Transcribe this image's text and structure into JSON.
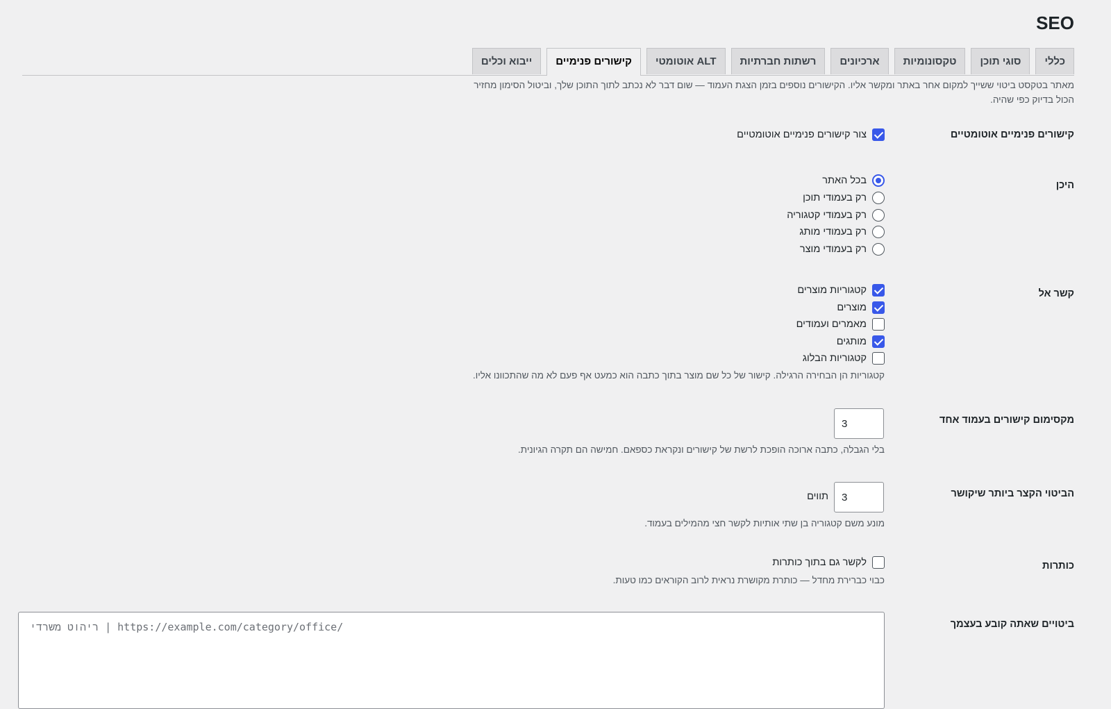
{
  "page": {
    "title": "SEO"
  },
  "tabs": [
    {
      "label": "כללי",
      "active": false
    },
    {
      "label": "סוגי תוכן",
      "active": false
    },
    {
      "label": "טקסונומיות",
      "active": false
    },
    {
      "label": "ארכיונים",
      "active": false
    },
    {
      "label": "רשתות חברתיות",
      "active": false
    },
    {
      "label": "ALT אוטומטי",
      "active": false
    },
    {
      "label": "קישורים פנימיים",
      "active": true
    },
    {
      "label": "ייבוא וכלים",
      "active": false
    }
  ],
  "intro": "מאתר בטקסט ביטוי ששייך למקום אחר באתר ומקשר אליו. הקישורים נוספים בזמן הצגת העמוד — שום דבר לא נכתב לתוך התוכן שלך, וביטול הסימון מחזיר הכול בדיוק כפי שהיה.",
  "auto_links": {
    "label": "קישורים פנימיים אוטומטיים",
    "option": {
      "label": "צור קישורים פנימיים אוטומטיים",
      "checked": true
    }
  },
  "where": {
    "label": "היכן",
    "options": [
      {
        "label": "בכל האתר",
        "checked": true
      },
      {
        "label": "רק בעמודי תוכן",
        "checked": false
      },
      {
        "label": "רק בעמודי קטגוריה",
        "checked": false
      },
      {
        "label": "רק בעמודי מותג",
        "checked": false
      },
      {
        "label": "רק בעמודי מוצר",
        "checked": false
      }
    ]
  },
  "link_to": {
    "label": "קשר אל",
    "options": [
      {
        "label": "קטגוריות מוצרים",
        "checked": true
      },
      {
        "label": "מוצרים",
        "checked": true
      },
      {
        "label": "מאמרים ועמודים",
        "checked": false
      },
      {
        "label": "מותגים",
        "checked": true
      },
      {
        "label": "קטגוריות הבלוג",
        "checked": false
      }
    ],
    "description": "קטגוריות הן הבחירה הרגילה. קישור של כל שם מוצר בתוך כתבה הוא כמעט אף פעם לא מה שהתכוונו אליו."
  },
  "max_links": {
    "label": "מקסימום קישורים בעמוד אחד",
    "value": "3",
    "description": "בלי הגבלה, כתבה ארוכה הופכת לרשת של קישורים ונקראת כספאם. חמישה הם תקרה הגיונית."
  },
  "min_phrase": {
    "label": "הביטוי הקצר ביותר שיקושר",
    "value": "3",
    "unit": "תווים",
    "description": "מונע משם קטגוריה בן שתי אותיות לקשר חצי מהמילים בעמוד."
  },
  "headings": {
    "label": "כותרות",
    "option": {
      "label": "לקשר גם בתוך כותרות",
      "checked": false
    },
    "description": "כבוי כברירת מחדל — כותרת מקושרת נראית לרוב הקוראים כמו טעות."
  },
  "custom_phrases": {
    "label": "ביטויים שאתה קובע בעצמך",
    "placeholder": "ריהוט משרדי | https://example.com/category/office/"
  }
}
